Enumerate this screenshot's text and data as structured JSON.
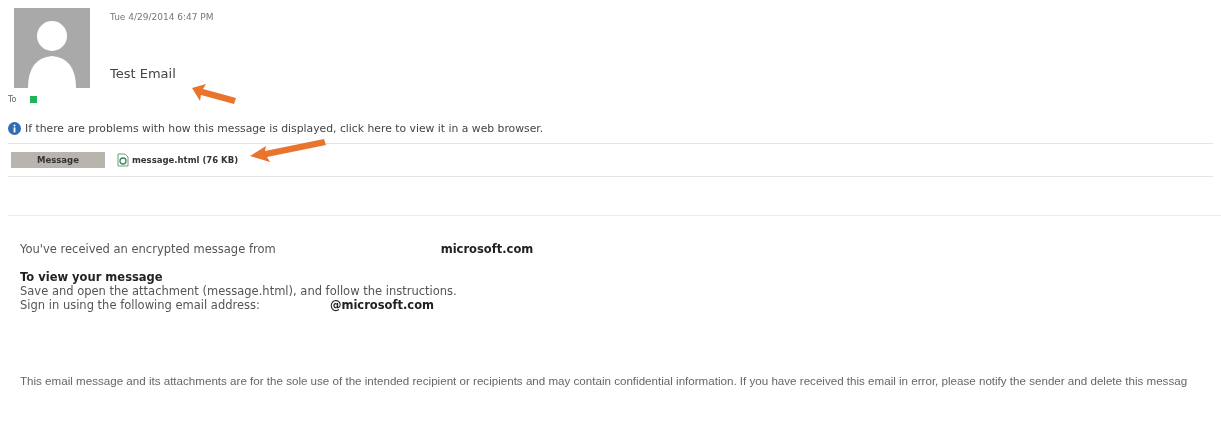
{
  "header": {
    "date": "Tue 4/29/2014 6:47 PM",
    "subject": "Test Email",
    "to_label": "To"
  },
  "info_bar": {
    "text": "If there are problems with how this message is displayed, click here to view it in a web browser."
  },
  "attachments": [
    {
      "kind": "message",
      "label": "Message",
      "selected": true
    },
    {
      "kind": "file",
      "label": "message.html (76 KB)",
      "selected": false
    }
  ],
  "body": {
    "intro": "You've received an encrypted message from",
    "sender_domain": "microsoft.com",
    "heading": "To view your message",
    "step": "Save and open the attachment (message.html), and follow the instructions.",
    "sign_in": "Sign in using the following email address:",
    "sign_in_domain": "@microsoft.com"
  },
  "footer": "This email message and its attachments are for the sole use of the intended recipient or recipients and may contain confidential information. If you have received this email in error, please notify the sender and delete this messag"
}
